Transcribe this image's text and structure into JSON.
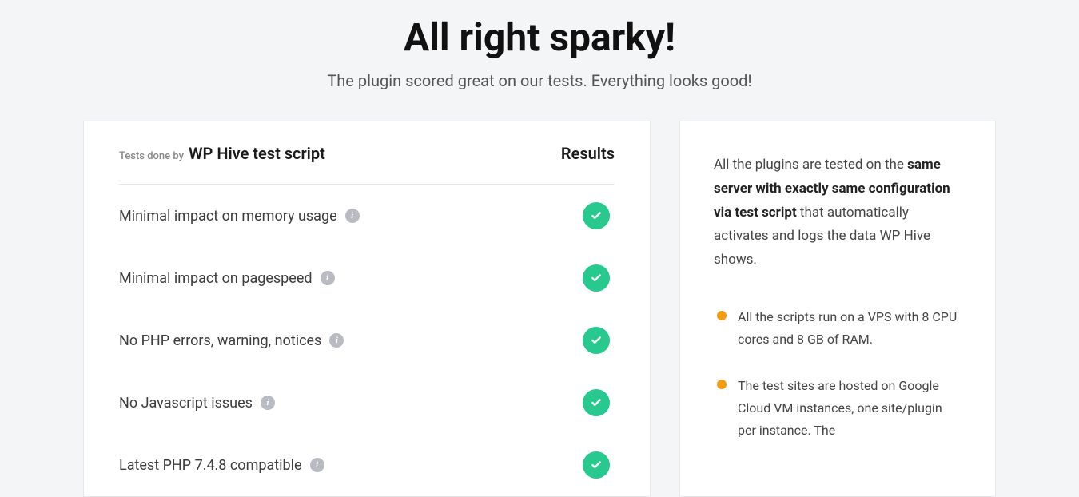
{
  "header": {
    "title": "All right sparky!",
    "subtitle": "The plugin scored great on our tests. Everything looks good!"
  },
  "tests": {
    "done_by_label": "Tests done by",
    "script_name": "WP Hive test script",
    "results_header": "Results",
    "items": [
      {
        "label": "Minimal impact on memory usage",
        "passed": true
      },
      {
        "label": "Minimal impact on pagespeed",
        "passed": true
      },
      {
        "label": "No PHP errors, warning, notices",
        "passed": true
      },
      {
        "label": "No Javascript issues",
        "passed": true
      },
      {
        "label": "Latest PHP 7.4.8 compatible",
        "passed": true
      }
    ]
  },
  "info": {
    "paragraph_pre": "All the plugins are tested on the ",
    "paragraph_bold": "same server with exactly same configuration via test script",
    "paragraph_post": " that automatically activates and logs the data WP Hive shows.",
    "list": [
      "All the scripts run on a VPS with 8 CPU cores and 8 GB of RAM.",
      "The test sites are hosted on Google Cloud VM instances, one site/plugin per instance. The"
    ]
  }
}
